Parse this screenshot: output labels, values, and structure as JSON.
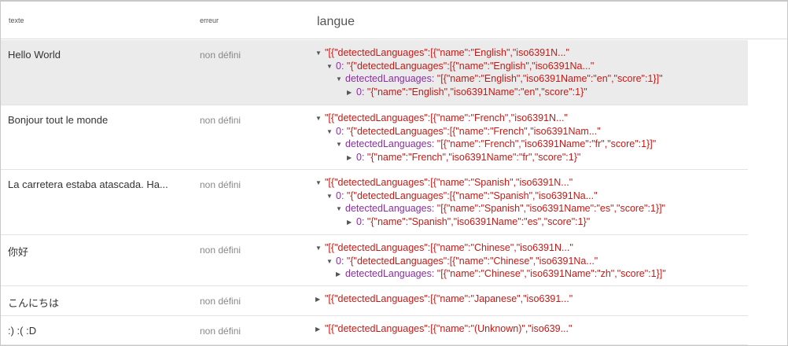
{
  "header": {
    "col_text": "texte",
    "col_error": "erreur",
    "col_lang": "langue"
  },
  "rows": [
    {
      "text": "Hello World",
      "error": "non défini",
      "lines": [
        "\"[{\"detectedLanguages\":[{\"name\":\"English\",\"iso6391N...\"",
        "\"{\"detectedLanguages\":[{\"name\":\"English\",\"iso6391Na...\"",
        "\"[{\"name\":\"English\",\"iso6391Name\":\"en\",\"score\":1}]\"",
        "\"{\"name\":\"English\",\"iso6391Name\":\"en\",\"score\":1}\""
      ]
    },
    {
      "text": "Bonjour tout le monde",
      "error": "non défini",
      "lines": [
        "\"[{\"detectedLanguages\":[{\"name\":\"French\",\"iso6391N...\"",
        "\"{\"detectedLanguages\":[{\"name\":\"French\",\"iso6391Nam...\"",
        "\"[{\"name\":\"French\",\"iso6391Name\":\"fr\",\"score\":1}]\"",
        "\"{\"name\":\"French\",\"iso6391Name\":\"fr\",\"score\":1}\""
      ]
    },
    {
      "text": "La carretera estaba atascada. Ha...",
      "error": "non défini",
      "lines": [
        "\"[{\"detectedLanguages\":[{\"name\":\"Spanish\",\"iso6391N...\"",
        "\"{\"detectedLanguages\":[{\"name\":\"Spanish\",\"iso6391Na...\"",
        "\"[{\"name\":\"Spanish\",\"iso6391Name\":\"es\",\"score\":1}]\"",
        "\"{\"name\":\"Spanish\",\"iso6391Name\":\"es\",\"score\":1}\""
      ]
    },
    {
      "text": "你好",
      "error": "non défini",
      "lines": [
        "\"[{\"detectedLanguages\":[{\"name\":\"Chinese\",\"iso6391N...\"",
        "\"{\"detectedLanguages\":[{\"name\":\"Chinese\",\"iso6391Na...\"",
        "\"[{\"name\":\"Chinese\",\"iso6391Name\":\"zh\",\"score\":1}]\""
      ]
    },
    {
      "text": "こんにちは",
      "error": "non défini",
      "lines": [
        "\"[{\"detectedLanguages\":[{\"name\":\"Japanese\",\"iso6391...\""
      ]
    },
    {
      "text": ":) :( :D",
      "error": "non défini",
      "lines": [
        "\"[{\"detectedLanguages\":[{\"name\":\"(Unknown)\",\"iso639...\""
      ]
    }
  ],
  "tree_keys": {
    "zero": "0:",
    "detected": "detectedLanguages:"
  },
  "colors": {
    "string": "#c41a16",
    "key": "#8b2fa0",
    "selected_row": "#ebebeb"
  }
}
